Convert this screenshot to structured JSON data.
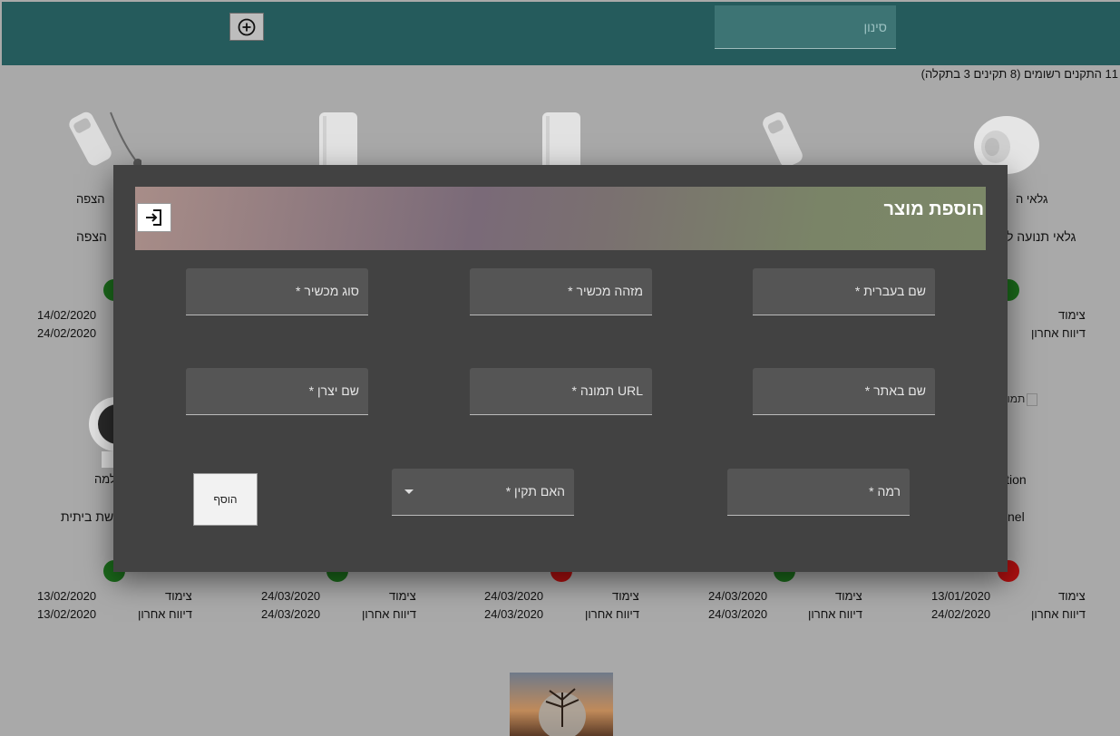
{
  "topbar": {
    "filter_placeholder": "סינון",
    "add_icon": "plus-circle-icon"
  },
  "summary": "11 התקנים רשומים (8 תקינים 3 בתקלה)",
  "labels": {
    "paired": "צימוד",
    "last_report": "דיווח אחרון"
  },
  "row1": [
    {
      "short": "גלאי ה",
      "name": "גלאי תנועה ל",
      "status": "ok",
      "paired_date": "",
      "report_date": ""
    },
    {
      "short": "הצפה",
      "name": "הצפה",
      "status": "ok",
      "paired_date": "14/02/2020",
      "report_date": "24/02/2020"
    }
  ],
  "row2": [
    {
      "short": "תמונ",
      "name": "nel",
      "extra": "ition",
      "status": "error",
      "paired_date": "13/01/2020",
      "report_date": "24/02/2020"
    },
    {
      "name": "",
      "status": "ok",
      "paired_date": "24/03/2020",
      "report_date": "24/03/2020"
    },
    {
      "name": "",
      "status": "error",
      "paired_date": "24/03/2020",
      "report_date": "24/03/2020"
    },
    {
      "name": "",
      "status": "ok",
      "paired_date": "24/03/2020",
      "report_date": "24/03/2020"
    },
    {
      "short": "למה",
      "name": "שת ביתית",
      "status": "ok",
      "paired_date": "13/02/2020",
      "report_date": "13/02/2020"
    }
  ],
  "colors": {
    "ok": "#1b6b1b",
    "error": "#b01010",
    "topbar": "#255b5c",
    "modal": "#424242"
  },
  "modal": {
    "title": "הוספת מוצר",
    "close_icon": "sign-in-icon",
    "fields": {
      "name_he": "שם בעברית *",
      "device_id": "מזהה מכשיר *",
      "device_type": "סוג מכשיר *",
      "site_name": "שם באתר *",
      "image_url": "URL תמונה *",
      "maker_name": "שם יצרן *",
      "level": "רמה *",
      "is_valid": "האם תקין *"
    },
    "add_label": "הוסף"
  }
}
